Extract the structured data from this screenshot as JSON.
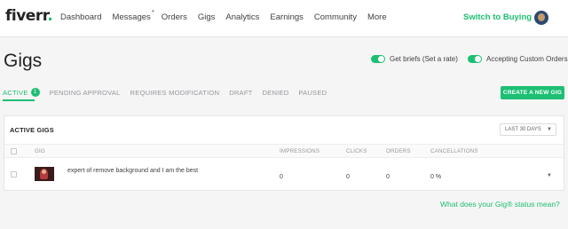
{
  "header": {
    "logo": "fiverr",
    "logo_dot": ".",
    "nav": [
      {
        "label": "Dashboard"
      },
      {
        "label": "Messages",
        "badge": "*"
      },
      {
        "label": "Orders"
      },
      {
        "label": "Gigs"
      },
      {
        "label": "Analytics"
      },
      {
        "label": "Earnings"
      },
      {
        "label": "Community"
      },
      {
        "label": "More"
      }
    ],
    "switch_label": "Switch to Buying"
  },
  "page": {
    "title": "Gigs",
    "toggles": [
      {
        "label": "Get briefs (Set a rate)",
        "on": true
      },
      {
        "label": "Accepting Custom Orders",
        "on": true
      }
    ]
  },
  "tabs": {
    "items": [
      {
        "label": "ACTIVE",
        "count": "1",
        "active": true
      },
      {
        "label": "PENDING APPROVAL"
      },
      {
        "label": "REQUIRES MODIFICATION"
      },
      {
        "label": "DRAFT"
      },
      {
        "label": "DENIED"
      },
      {
        "label": "PAUSED"
      }
    ],
    "create_button": "CREATE A NEW GIG"
  },
  "panel": {
    "title": "ACTIVE GIGS",
    "range": "LAST 30 DAYS",
    "caret": "▼",
    "columns": [
      "GIG",
      "IMPRESSIONS",
      "CLICKS",
      "ORDERS",
      "CANCELLATIONS"
    ],
    "rows": [
      {
        "title": "expert of remove background and I am the best",
        "impressions": "0",
        "clicks": "0",
        "orders": "0",
        "cancellations": "0 %"
      }
    ]
  },
  "help_link": "What does your Gig® status mean?",
  "colors": {
    "accent": "#1dbf73",
    "text": "#404145",
    "muted": "#95979d",
    "background": "#f5f5f5"
  }
}
